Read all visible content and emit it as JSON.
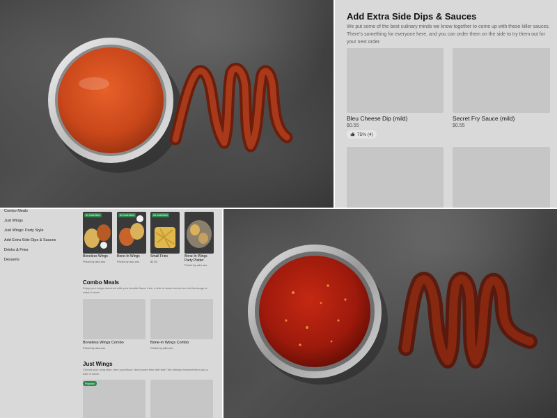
{
  "colors": {
    "panel_gray": "#d9d9d9",
    "placeholder_gray": "#c6c6c6",
    "accent_green": "#2c8a4c",
    "buffalo_sauce": "#c9471a",
    "sweet_chili_sauce": "#9e1a0c"
  },
  "dips_section": {
    "title": "Add Extra Side Dips & Sauces",
    "description": "We put some of the best culinary minds we know together to come up with these killer sauces. There's something for everyone here, and you can order them on the side to try them out for your next order.",
    "items": [
      {
        "name": "Bleu Cheese Dip (mild)",
        "price": "$0.55",
        "rating": "75% (4)",
        "rating_icon": "thumbs-up-icon"
      },
      {
        "name": "Secret Fry Sauce (mild)",
        "price": "$0.55"
      }
    ]
  },
  "menu": {
    "categories": [
      "Combo Meals",
      "Just Wings",
      "Just Wings: Party Style",
      "Add Extra Side Dips & Sauces",
      "Drinks & Fries",
      "Desserts"
    ],
    "featured": [
      {
        "badge": "#1 most liked",
        "name": "Boneless Wings",
        "sub": "Priced by add-ons"
      },
      {
        "badge": "#2 most liked",
        "name": "Bone-In Wings",
        "sub": "Priced by add-ons"
      },
      {
        "badge": "#3 most liked",
        "name": "Small Fries",
        "sub": "$2.50"
      },
      {
        "name": "Bone-In Wings Party Platter",
        "sub": "Priced by add-ons"
      }
    ],
    "combo_section": {
      "title": "Combo Meals",
      "description": "Enjoy your wings drenched with your favorite flavor, fries, a side of ranch and an ice cold beverage or watch it down",
      "items": [
        {
          "name": "Boneless Wings Combo",
          "sub": "Priced by add-ons"
        },
        {
          "name": "Bone-In Wings Combo",
          "sub": "Priced by add-ons"
        }
      ]
    },
    "wings_section": {
      "title": "Just Wings",
      "description": "Choose your wing style, then your flavor. Need some fries with that? We already included them plus a side of ranch.",
      "popular_label": "Popular"
    }
  }
}
